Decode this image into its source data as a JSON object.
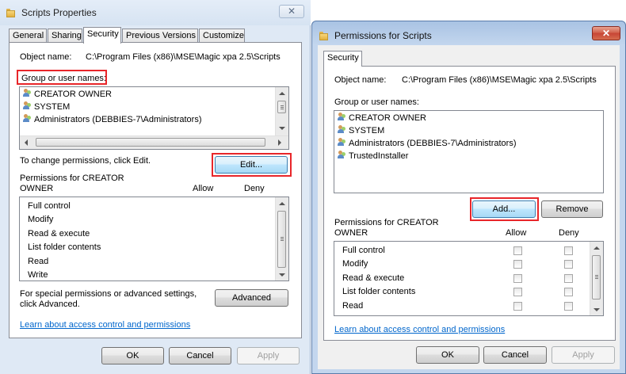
{
  "left": {
    "title": "Scripts Properties",
    "tabs": [
      "General",
      "Sharing",
      "Security",
      "Previous Versions",
      "Customize"
    ],
    "object_name_label": "Object name:",
    "object_name_value": "C:\\Program Files (x86)\\MSE\\Magic xpa 2.5\\Scripts",
    "group_label": "Group or user names:",
    "users": [
      "CREATOR OWNER",
      "SYSTEM",
      "Administrators (DEBBIES-7\\Administrators)"
    ],
    "change_hint": "To change permissions, click Edit.",
    "edit_label": "Edit...",
    "perm_label_line1": "Permissions for CREATOR",
    "perm_label_line2": "OWNER",
    "allow_header": "Allow",
    "deny_header": "Deny",
    "permissions": [
      "Full control",
      "Modify",
      "Read & execute",
      "List folder contents",
      "Read",
      "Write"
    ],
    "special_line1": "For special permissions or advanced settings,",
    "special_line2": "click Advanced.",
    "advanced_label": "Advanced",
    "learn_link": "Learn about access control and permissions",
    "ok_label": "OK",
    "cancel_label": "Cancel",
    "apply_label": "Apply"
  },
  "right": {
    "title": "Permissions for Scripts",
    "tab": "Security",
    "object_name_label": "Object name:",
    "object_name_value": "C:\\Program Files (x86)\\MSE\\Magic xpa 2.5\\Scripts",
    "group_label": "Group or user names:",
    "users": [
      "CREATOR OWNER",
      "SYSTEM",
      "Administrators (DEBBIES-7\\Administrators)",
      "TrustedInstaller"
    ],
    "add_label": "Add...",
    "remove_label": "Remove",
    "perm_label_line1": "Permissions for CREATOR",
    "perm_label_line2": "OWNER",
    "allow_header": "Allow",
    "deny_header": "Deny",
    "permissions": [
      "Full control",
      "Modify",
      "Read & execute",
      "List folder contents",
      "Read"
    ],
    "learn_link": "Learn about access control and permissions",
    "ok_label": "OK",
    "cancel_label": "Cancel",
    "apply_label": "Apply"
  },
  "colors": {
    "highlight_border": "#e8262a",
    "link": "#0066cc",
    "titlebar_left": "#dfe9f5",
    "titlebar_right": "#a9c3e3",
    "close_button_red": "#c74536"
  }
}
